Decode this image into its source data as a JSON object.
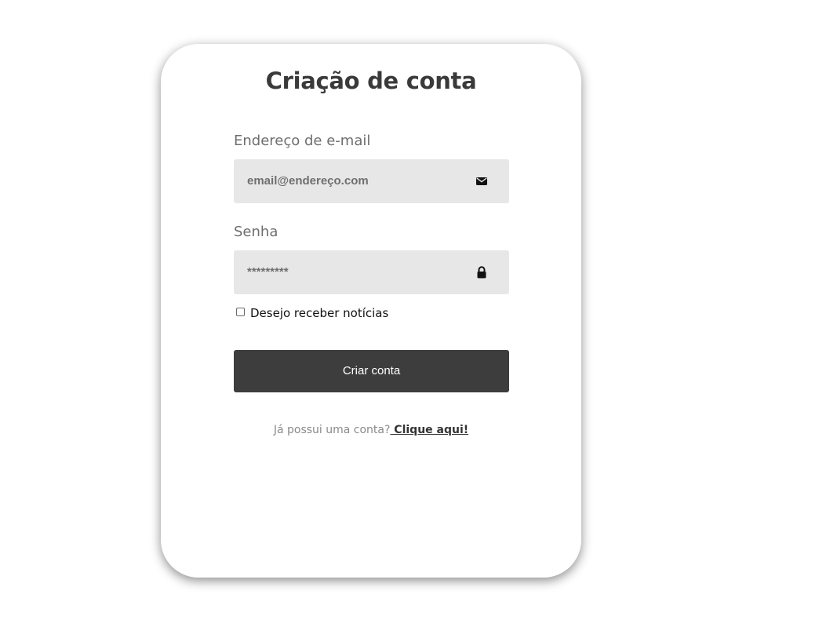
{
  "form": {
    "title": "Criação de conta",
    "email_label": "Endereço de e-mail",
    "email_placeholder": "email@endereço.com",
    "email_icon": "envelope-icon",
    "password_label": "Senha",
    "password_placeholder": "*********",
    "password_icon": "lock-icon",
    "newsletter_label": "Desejo receber notícias",
    "newsletter_checked": false,
    "submit_label": "Criar conta",
    "login_prompt": "Já possui uma conta?",
    "login_link": " Clique aqui!"
  },
  "colors": {
    "button_bg": "#3d3d3d",
    "input_bg": "#e7e7e7",
    "title": "#3a3a3a",
    "label": "#6e6e6e"
  }
}
